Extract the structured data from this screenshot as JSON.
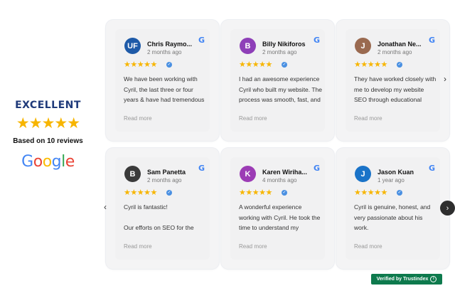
{
  "summary": {
    "rating_label": "EXCELLENT",
    "stars": "★★★★★",
    "based_on": "Based on 10 reviews",
    "logo_text": "Google"
  },
  "colors": {
    "star": "#f7b500",
    "badge_bg": "#0e7a4d",
    "verified": "#4a90e2"
  },
  "reviews": [
    {
      "name": "Chris Raymo...",
      "date": "2 months ago",
      "stars": "★★★★★",
      "avatar_text": "UF",
      "avatar_color": "#1e5aa8",
      "text": "We have been working with Cyril, the last three or four years & have had tremendous SEO results",
      "read_more": "Read more"
    },
    {
      "name": "Billy Nikiforos",
      "date": "2 months ago",
      "stars": "★★★★★",
      "avatar_text": "B",
      "avatar_color": "#8e3fb8",
      "text": "I had an awesome experience Cyril who built my website. The process was smooth, fast, and",
      "read_more": "Read more"
    },
    {
      "name": "Jonathan Ne...",
      "date": "2 months ago",
      "stars": "★★★★★",
      "avatar_text": "J",
      "avatar_color": "#9a6a50",
      "text": "They have worked closely with me to develop my website SEO through educational content",
      "read_more": "Read more"
    },
    {
      "name": "Sam Panetta",
      "date": "2 months ago",
      "stars": "★★★★★",
      "avatar_text": "B",
      "avatar_color": "#3a3a3a",
      "text": "Cyril is fantastic!\n\nOur efforts on SEO for the BOOKED COACH website",
      "read_more": "Read more"
    },
    {
      "name": "Karen Wiriha...",
      "date": "4 months ago",
      "stars": "★★★★★",
      "avatar_text": "K",
      "avatar_color": "#9c3cb5",
      "text": "A wonderful experience working with Cyril. He took the time to understand my business and brand and",
      "read_more": "Read more"
    },
    {
      "name": "Jason Kuan",
      "date": "1 year ago",
      "stars": "★★★★★",
      "avatar_text": "J",
      "avatar_color": "#1a73c8",
      "text": "Cyril is genuine, honest, and very passionate about his work.",
      "read_more": "Read more"
    }
  ],
  "nav": {
    "next_arrow": "›",
    "prev_arrow": "‹",
    "next_arrow_dark": "›"
  },
  "badge": {
    "text": "Verified by Trustindex",
    "info": "i"
  },
  "google_g": "G",
  "verified_check": "✓"
}
